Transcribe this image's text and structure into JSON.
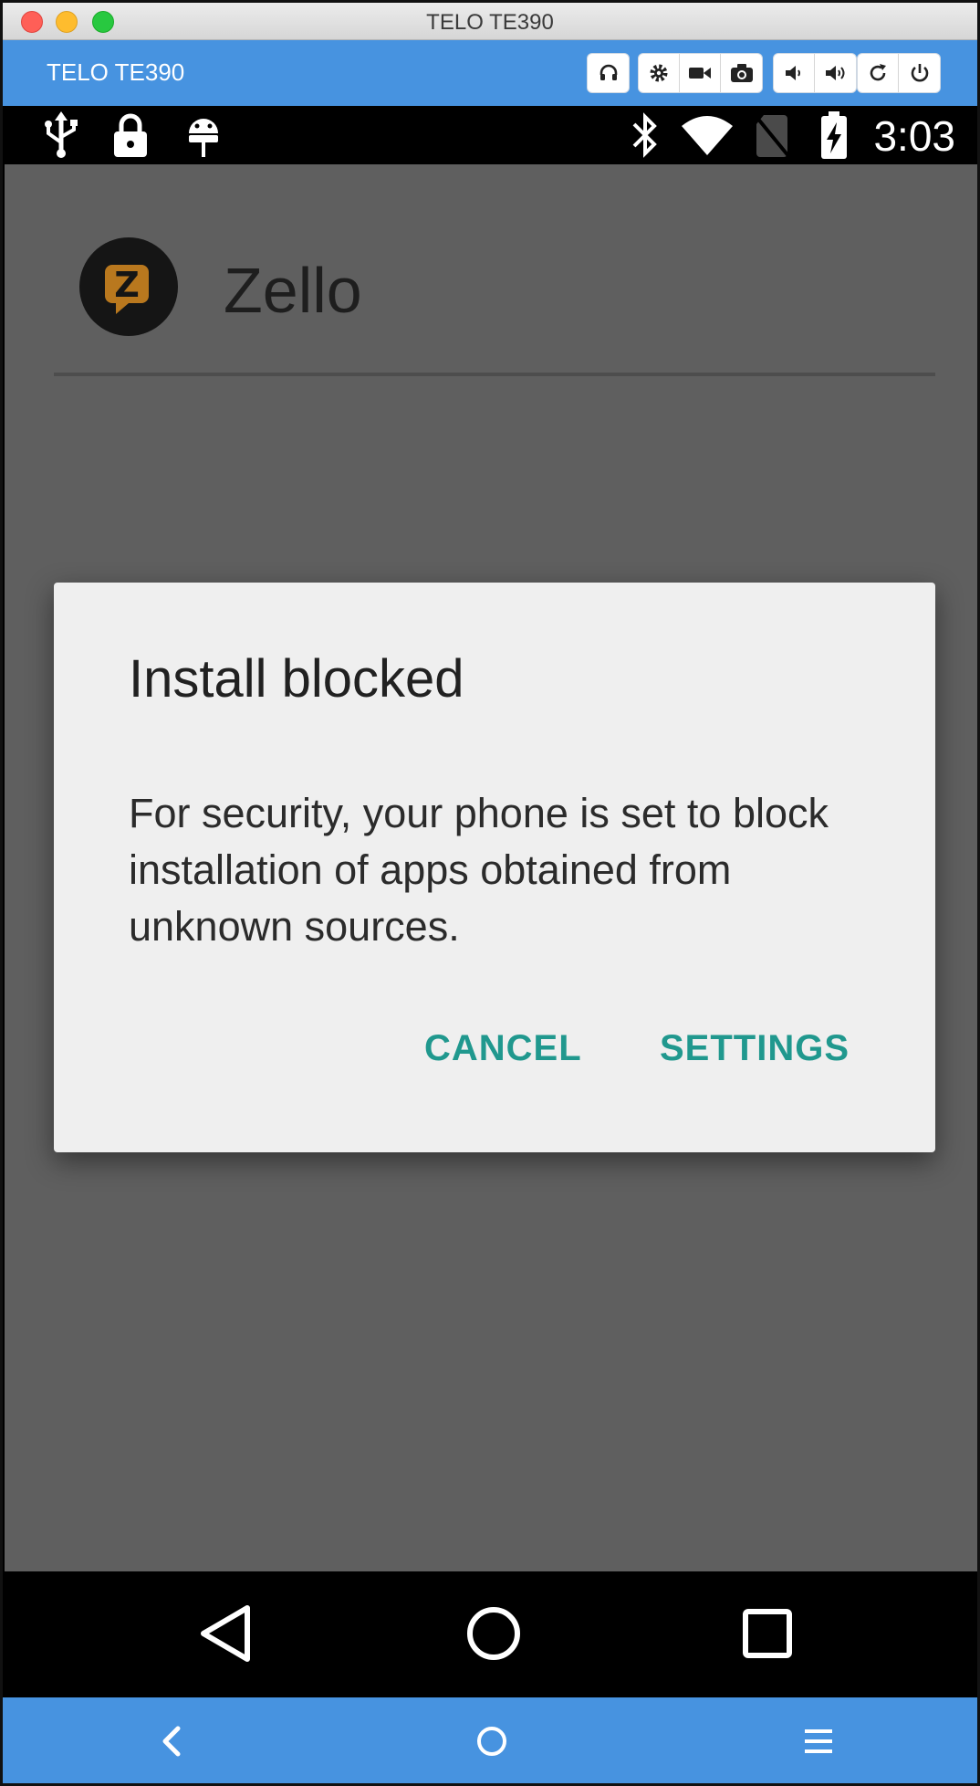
{
  "window": {
    "title": "TELO TE390"
  },
  "toolbar": {
    "device_name": "TELO TE390"
  },
  "status_bar": {
    "time": "3:03"
  },
  "app": {
    "name": "Zello",
    "logo_letter": "Z"
  },
  "dialog": {
    "title": "Install blocked",
    "message": "For security, your phone is set to block installation of apps obtained from unknown sources.",
    "cancel_label": "CANCEL",
    "settings_label": "SETTINGS"
  },
  "colors": {
    "toolbar": "#4793e0",
    "accent": "#20988e",
    "dim_background": "#5f5f5f",
    "dialog": "#efefef"
  }
}
